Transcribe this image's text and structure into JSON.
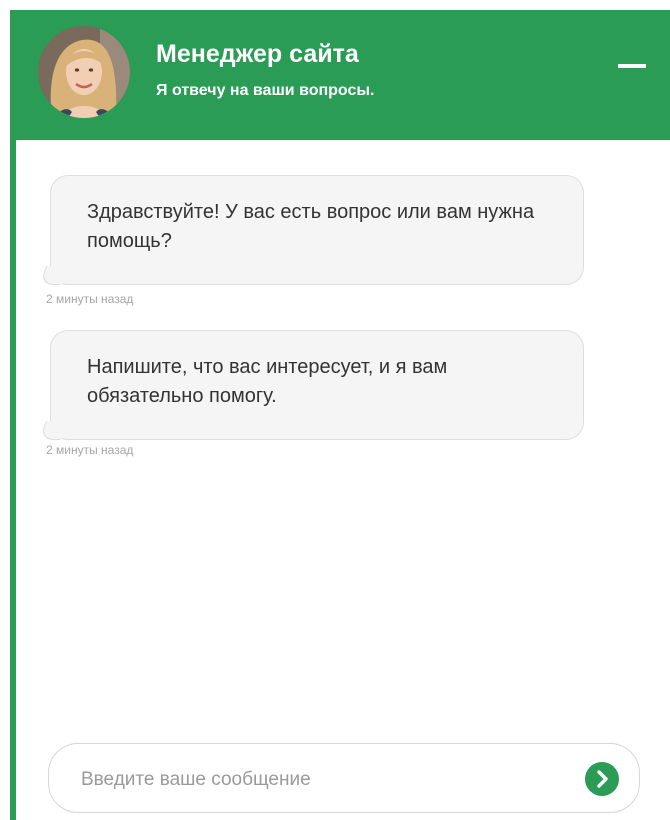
{
  "header": {
    "title": "Менеджер сайта",
    "subtitle": "Я отвечу на ваши вопросы.",
    "minimize_icon": "minus-icon",
    "accent_color": "#2a9c55"
  },
  "messages": [
    {
      "text": "Здравствуйте! У вас есть вопрос или вам нужна помощь?",
      "timestamp": "2 минуты назад"
    },
    {
      "text": "Напишите, что вас интересует, и я вам обязательно помогу.",
      "timestamp": "2 минуты назад"
    }
  ],
  "composer": {
    "placeholder": "Введите ваше сообщение",
    "value": "",
    "send_icon": "chevron-right-icon"
  }
}
